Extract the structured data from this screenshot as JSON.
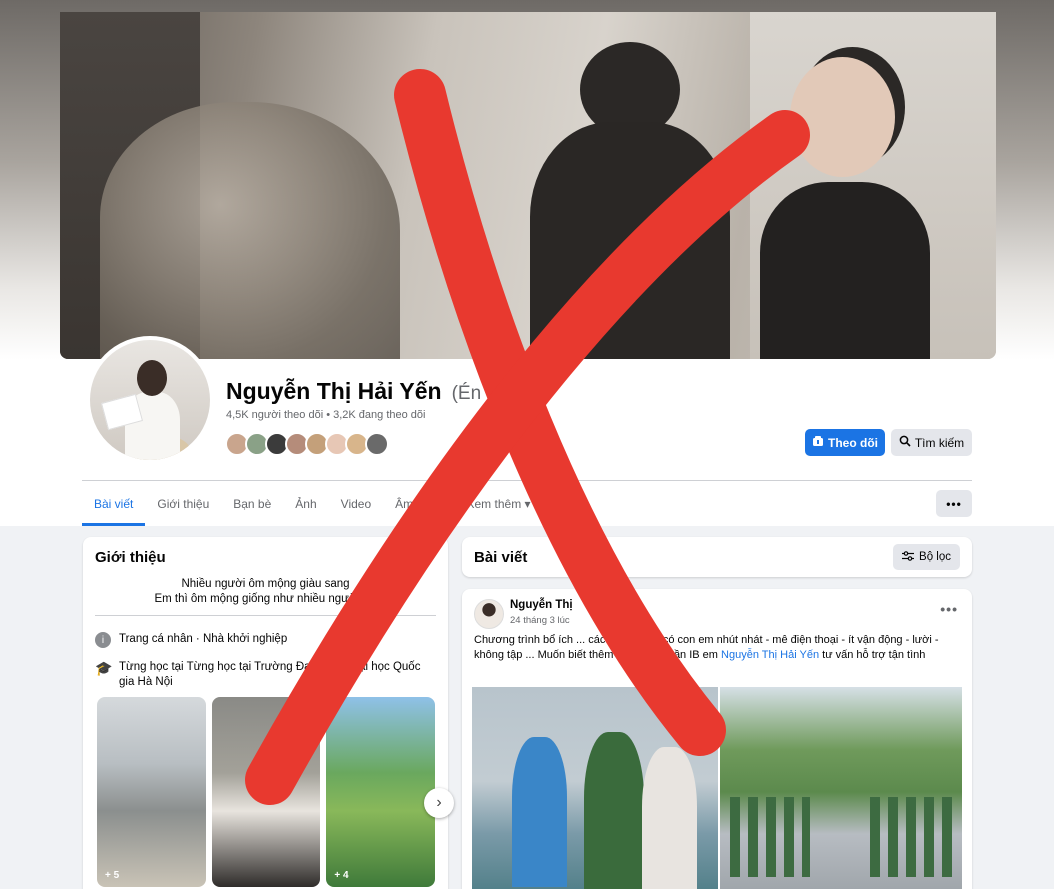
{
  "profile": {
    "name": "Nguyễn Thị Hải Yến",
    "alt_name": "(Én",
    "stats": "4,5K người theo dõi • 3,2K đang theo dõi",
    "friend_avatar_colors": [
      "#c9a58d",
      "#8aa187",
      "#3b3b3b",
      "#b58c7a",
      "#c4a07a",
      "#e7c7b5",
      "#d8b58b",
      "#6a6a6a"
    ]
  },
  "buttons": {
    "follow": "Theo dõi",
    "search": "Tìm kiếm",
    "more": "•••"
  },
  "tabs": [
    {
      "label": "Bài viết",
      "active": true
    },
    {
      "label": "Giới thiệu"
    },
    {
      "label": "Bạn bè"
    },
    {
      "label": "Ảnh"
    },
    {
      "label": "Video"
    },
    {
      "label": "Âm nhạc"
    },
    {
      "label": "Xem thêm ▾"
    }
  ],
  "intro": {
    "title": "Giới thiệu",
    "bio_line1": "Nhiều người ôm mộng giàu sang",
    "bio_line2": "Em thì ôm mộng giống như nhiều người 🙂",
    "work": "Trang cá nhân · Nhà khởi nghiệp",
    "education": "Từng học tại Từng học tại Trường Đại học ... Đại học Quốc gia Hà Nội",
    "photo_counts": [
      "+ 5",
      "",
      "+ 4"
    ]
  },
  "posts": {
    "title": "Bài viết",
    "filter_label": "Bộ lọc",
    "items": [
      {
        "author": "Nguyễn Thị",
        "time": "24 tháng 3 lúc",
        "text_before": "Chương trình bổ ích ... các phụ huynh có con em nhút nhát - mê điện thoại - ít vận động - lười - không tập ... Muốn biết thêm chi tiết chỉ cần IB em ",
        "mention": "Nguyễn Thị Hải Yến",
        "text_after": " tư vấn hỗ trợ tận tình"
      }
    ]
  },
  "colors": {
    "accent": "#1b74e4",
    "cross": "#e8392f"
  }
}
